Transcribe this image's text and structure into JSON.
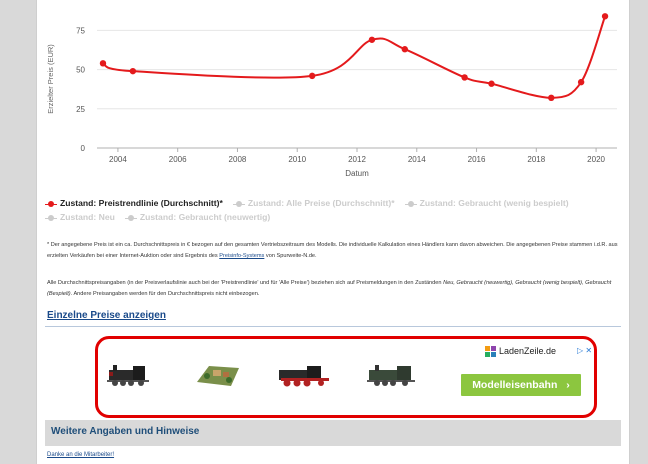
{
  "chart_data": {
    "type": "line",
    "xlabel": "Datum",
    "ylabel": "Erzielter Preis (EUR)",
    "x_ticks": [
      "2004",
      "2006",
      "2008",
      "2010",
      "2012",
      "2014",
      "2016",
      "2018",
      "2020"
    ],
    "y_ticks": [
      "0",
      "25",
      "50",
      "75"
    ],
    "xlim": [
      2003.3,
      2020.7
    ],
    "ylim": [
      0,
      88
    ],
    "series": [
      {
        "name": "Zustand: Preistrendlinie (Durchschnitt)*",
        "color": "#e41a1c",
        "x": [
          2003.5,
          2004.5,
          2010.5,
          2012.5,
          2013.6,
          2015.6,
          2016.5,
          2018.5,
          2019.5,
          2020.3
        ],
        "y": [
          54,
          49,
          46,
          69,
          63,
          45,
          41,
          32,
          42,
          84
        ]
      }
    ]
  },
  "legend": [
    {
      "label": "Zustand: Preistrendlinie (Durchschnitt)*",
      "state": "active",
      "symbol": "line-dot"
    },
    {
      "label": "Zustand: Alle Preise (Durchschnitt)*",
      "state": "inactive",
      "symbol": "line-dot"
    },
    {
      "label": "Zustand: Gebraucht (wenig bespielt)",
      "state": "inactive",
      "symbol": "line-dot"
    },
    {
      "label": "Zustand: Neu",
      "state": "inactive",
      "symbol": "line-dot"
    },
    {
      "label": "Zustand: Gebraucht (neuwertig)",
      "state": "inactive",
      "symbol": "line-dot"
    }
  ],
  "notes": {
    "p1_a": "* Der angegebene Preis ist ein ca. Durchschnittspreis in € bezogen auf den gesamten Vertriebszeitraum des Modells. Die individuelle Kalkulation eines Händlers kann davon abweichen. Die angegebenen Preise stammen i.d.R. aus erzielten Verkäufen bei einer Internet-Auktion oder sind Ergebnis des ",
    "p1_link": "Preisinfo-Systems",
    "p1_b": " von Spurweite-N.de.",
    "p2_a": "Alle Durchschnittspreisangaben (in der Preisverlaufslinie auch bei der 'Preistrendlinie' und für 'Alle Preise') beziehen sich auf Preismeldungen in den Zuständen ",
    "p2_i1": "Neu, Gebraucht (neuwertig), Gebraucht (wenig bespielt), Gebraucht (Bespielt)",
    "p2_b": ". Andere Preisangaben werden für den Durchschnittspreis nicht einbezogen."
  },
  "single_prices_link": "Einzelne Preise anzeigen",
  "ad": {
    "brand": "LadenZeile.de",
    "cta": "Modelleisenbahn",
    "cta_arrow": "›",
    "close_glyphs": "▷ ✕",
    "item_icons": [
      "steam-locomotive",
      "layout-diorama",
      "red-locomotive",
      "green-locomotive"
    ]
  },
  "section_title": "Weitere Angaben und Hinweise",
  "thanks_link": "Danke an die Mitarbeiter!"
}
